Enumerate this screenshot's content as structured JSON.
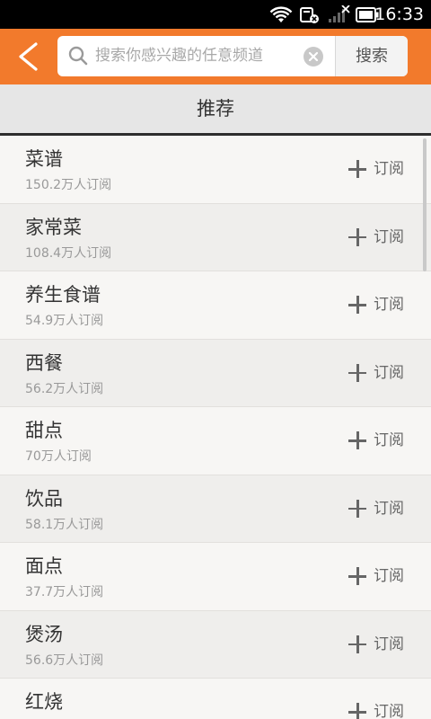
{
  "status_bar": {
    "time": "16:33",
    "icons": [
      "wifi-icon",
      "notification-icon",
      "signal-icon",
      "battery-icon"
    ]
  },
  "header": {
    "back_icon": "back-chevron-icon",
    "search": {
      "placeholder": "搜索你感兴趣的任意频道",
      "button_label": "搜索"
    }
  },
  "section": {
    "title": "推荐"
  },
  "subscribe_label": "订阅",
  "channels": [
    {
      "name": "菜谱",
      "subscribers": "150.2万人订阅"
    },
    {
      "name": "家常菜",
      "subscribers": "108.4万人订阅"
    },
    {
      "name": "养生食谱",
      "subscribers": "54.9万人订阅"
    },
    {
      "name": "西餐",
      "subscribers": "56.2万人订阅"
    },
    {
      "name": "甜点",
      "subscribers": "70万人订阅"
    },
    {
      "name": "饮品",
      "subscribers": "58.1万人订阅"
    },
    {
      "name": "面点",
      "subscribers": "37.7万人订阅"
    },
    {
      "name": "煲汤",
      "subscribers": "56.6万人订阅"
    },
    {
      "name": "红烧",
      "subscribers": ""
    }
  ],
  "colors": {
    "accent": "#f27a2c",
    "status_bar": "#000000",
    "header_bg": "#e6e6e6"
  }
}
